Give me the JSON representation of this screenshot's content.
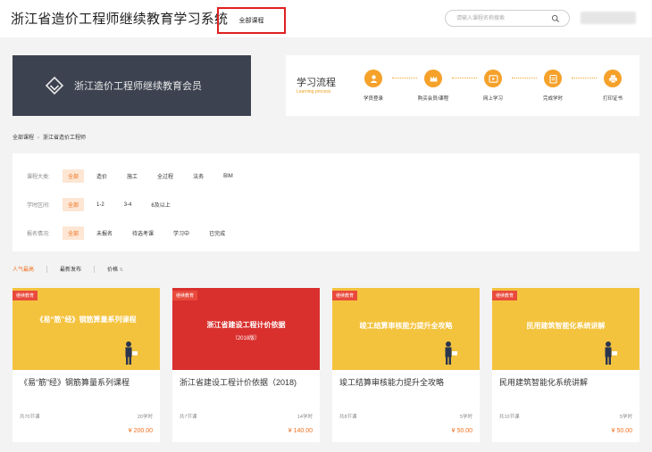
{
  "header": {
    "site_title": "浙江省造价工程师继续教育学习系统",
    "nav_all_courses": "全部课程",
    "search_placeholder": "请输入课程名称搜索"
  },
  "banner": {
    "text": "浙江造价工程师继续教育会员"
  },
  "flow": {
    "title": "学习流程",
    "subtitle": "Learning process",
    "steps": [
      {
        "label": "学员登录",
        "icon": "user-icon"
      },
      {
        "label": "购买会员/课程",
        "icon": "crown-icon"
      },
      {
        "label": "网上学习",
        "icon": "play-icon"
      },
      {
        "label": "完成学时",
        "icon": "clipboard-icon"
      },
      {
        "label": "打印证书",
        "icon": "printer-icon"
      }
    ]
  },
  "breadcrumb": {
    "root": "全部课程",
    "current": "浙江省造价工程师"
  },
  "filters": {
    "category": {
      "label": "课程大类:",
      "options": [
        "全部",
        "造价",
        "施工",
        "全过程",
        "法务",
        "BIM"
      ]
    },
    "hours": {
      "label": "学时区间:",
      "options": [
        "全部",
        "1-2",
        "3-4",
        "6及以上"
      ]
    },
    "status": {
      "label": "报名情况:",
      "options": [
        "全部",
        "未报名",
        "待选考课",
        "学习中",
        "已完成"
      ]
    }
  },
  "sort": {
    "options": [
      "人气最高",
      "最新发布",
      "价格"
    ]
  },
  "tag_label": "继续教育",
  "courses": [
    {
      "thumb_title": "《易“筋”经》钢筋算量系列课程",
      "title": "《易“筋”经》钢筋算量系列课程",
      "nodes": "共70节课",
      "hours": "20学时",
      "price": "¥ 200.00",
      "theme": "yellow"
    },
    {
      "thumb_title": "浙江省建设工程计价依据",
      "thumb_sub": "（2018版）",
      "title": "浙江省建设工程计价依据（2018)",
      "nodes": "共7节课",
      "hours": "14学时",
      "price": "¥ 140.00",
      "theme": "red"
    },
    {
      "thumb_title": "竣工结算审核能力提升全攻略",
      "title": "竣工结算审核能力提升全攻略",
      "nodes": "共8节课",
      "hours": "5学时",
      "price": "¥ 50.00",
      "theme": "yellow"
    },
    {
      "thumb_title": "民用建筑智能化系统讲解",
      "title": "民用建筑智能化系统讲解",
      "nodes": "共10节课",
      "hours": "5学时",
      "price": "¥ 50.00",
      "theme": "yellow"
    }
  ],
  "colors": {
    "accent": "#f07020",
    "highlight_box": "#e02020",
    "banner_bg": "#3c4250",
    "card_yellow": "#f4c33e",
    "card_red": "#d9302e"
  }
}
